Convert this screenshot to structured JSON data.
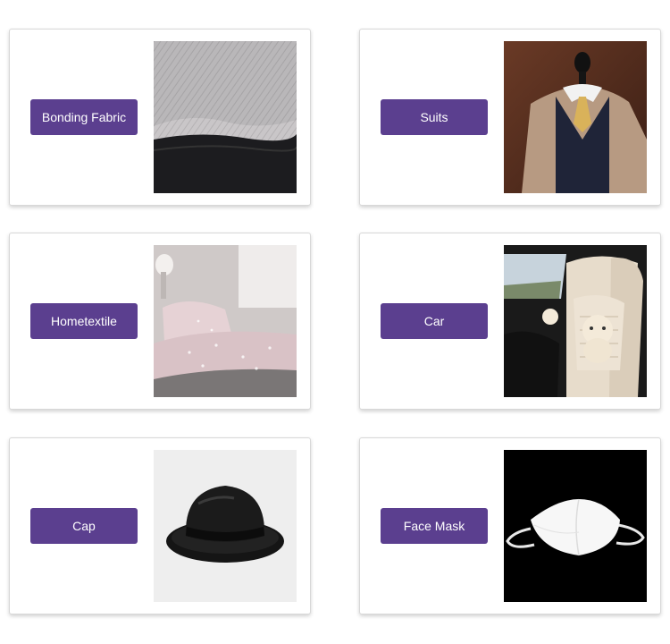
{
  "categories": [
    {
      "label": "Bonding Fabric",
      "image": "fabric-photo"
    },
    {
      "label": "Suits",
      "image": "suit-photo"
    },
    {
      "label": "Hometextile",
      "image": "bedding-photo"
    },
    {
      "label": "Car",
      "image": "car-seat-photo"
    },
    {
      "label": "Cap",
      "image": "bowler-hat-photo"
    },
    {
      "label": "Face Mask",
      "image": "face-mask-photo"
    }
  ],
  "colors": {
    "button": "#5b3f8f",
    "button_text": "#ffffff",
    "card_border": "#d8d8d8"
  }
}
